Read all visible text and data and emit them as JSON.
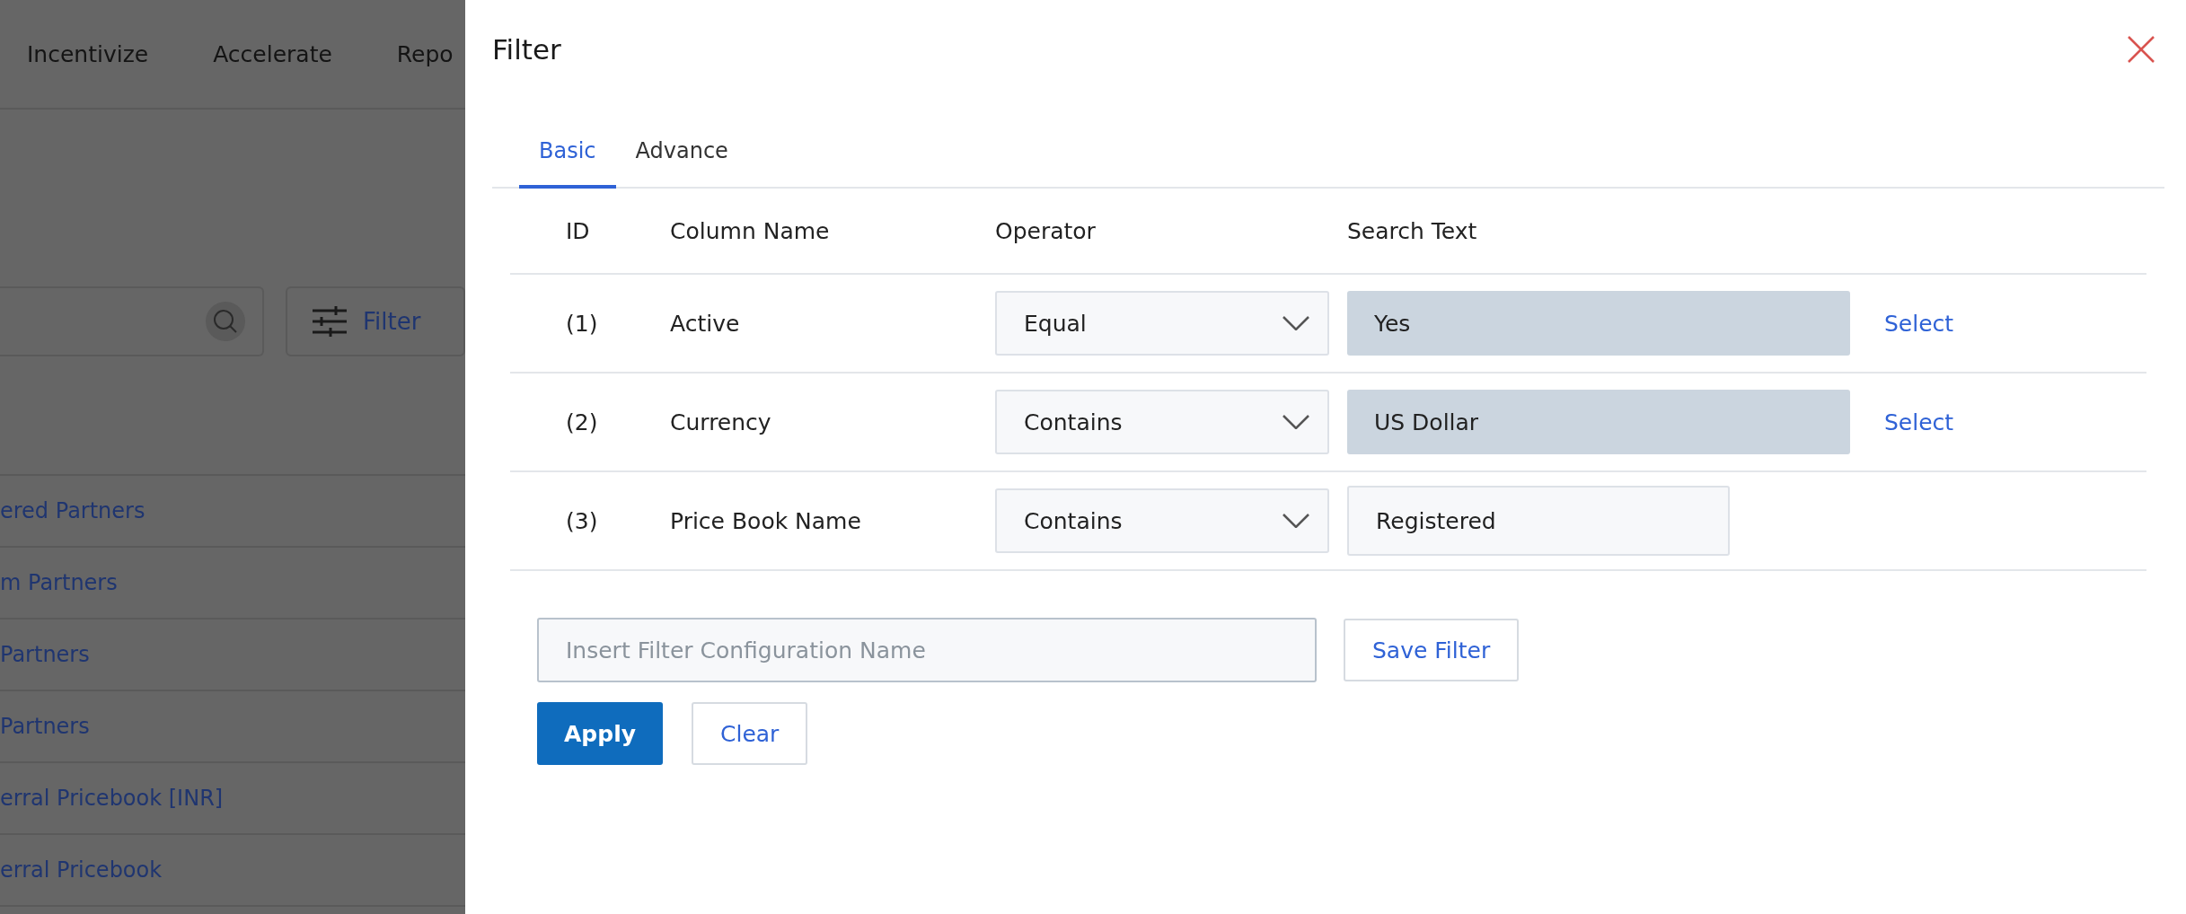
{
  "background": {
    "nav_items": [
      "Incentivize",
      "Accelerate",
      "Repo"
    ],
    "filter_button": "Filter",
    "list_items": [
      "ered Partners",
      "m Partners",
      "Partners",
      "Partners",
      "erral Pricebook [INR]",
      "erral Pricebook"
    ]
  },
  "dialog": {
    "title": "Filter",
    "tabs": [
      {
        "label": "Basic",
        "selected": true
      },
      {
        "label": "Advance",
        "selected": false
      }
    ],
    "columns": [
      "ID",
      "Column Name",
      "Operator",
      "Search Text"
    ],
    "rows": [
      {
        "id": "(1)",
        "column": "Active",
        "operator": "Equal",
        "search_text": "Yes",
        "kind": "lookup",
        "select_link": "Select"
      },
      {
        "id": "(2)",
        "column": "Currency",
        "operator": "Contains",
        "search_text": "US Dollar",
        "kind": "lookup",
        "select_link": "Select"
      },
      {
        "id": "(3)",
        "column": "Price Book Name",
        "operator": "Contains",
        "search_text": "Registered",
        "kind": "text"
      }
    ],
    "config_name": {
      "placeholder": "Insert Filter Configuration Name"
    },
    "save_button": "Save Filter",
    "apply_button": "Apply",
    "clear_button": "Clear"
  }
}
